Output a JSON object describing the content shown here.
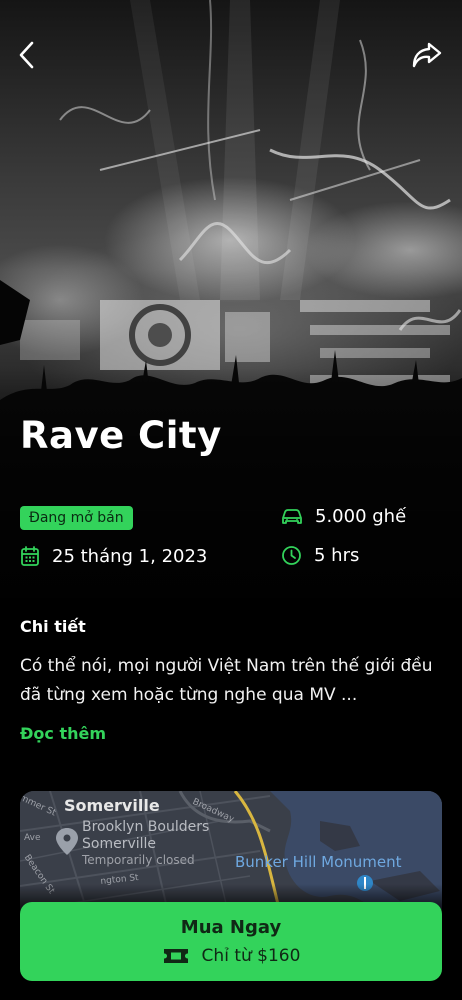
{
  "event": {
    "title": "Rave City",
    "status_badge": "Đang mở bán",
    "seats": "5.000 ghế",
    "date": "25 tháng 1, 2023",
    "duration": "5 hrs"
  },
  "details": {
    "heading": "Chi tiết",
    "description": "Có thể nói, mọi người Việt Nam trên thế giới đều đã từng xem hoặc từng nghe qua MV ...",
    "read_more": "Đọc thêm"
  },
  "map": {
    "area_label": "Somerville",
    "place_name": "Brooklyn Boulders",
    "place_sub": "Somerville",
    "place_status": "Temporarily closed",
    "landmark": "Bunker Hill Monument",
    "street_broadway": "Broadway",
    "street_summer": "mmer St",
    "street_ave": "Ave",
    "street_beacon": "Beacon St",
    "street_washington": "ngton St"
  },
  "cta": {
    "label": "Mua Ngay",
    "price": "Chỉ từ $160"
  },
  "icons": {
    "back": "chevron-left-icon",
    "share": "share-forward-icon",
    "seats": "car-icon",
    "date": "calendar-icon",
    "duration": "clock-icon",
    "ticket": "ticket-icon",
    "map_pin": "map-pin-icon"
  },
  "colors": {
    "accent": "#33d35b",
    "background": "#000000",
    "map_water": "#3b4a66",
    "map_land": "#3a3f49"
  }
}
